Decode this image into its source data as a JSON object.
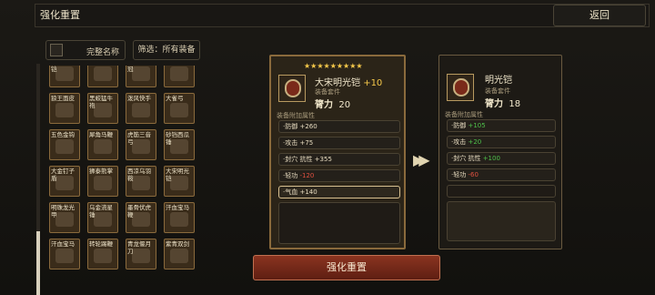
{
  "header": {
    "title": "强化重置",
    "back_label": "返回"
  },
  "left": {
    "show_full_name_label": "完整名称",
    "filter_label": "筛选：所有装备",
    "items": [
      {
        "label": "大宋明光铠"
      },
      {
        "label": "秋水长天"
      },
      {
        "label": "凤翅紫金冠"
      },
      {
        "label": "鸳鸯钺"
      },
      {
        "label": "狼王面皮"
      },
      {
        "label": "黑蛟猛牛袍"
      },
      {
        "label": "泼风快手"
      },
      {
        "label": "大雀弓"
      },
      {
        "label": "五色金钩"
      },
      {
        "label": "犀角马鞭"
      },
      {
        "label": "虎筋三音弓"
      },
      {
        "label": "砂铛西瓜锤"
      },
      {
        "label": "大金钉子盾"
      },
      {
        "label": "狮泰熊掌"
      },
      {
        "label": "西凉乌羽鞍"
      },
      {
        "label": "大宋明光铠"
      },
      {
        "label": "明珠龙光甲"
      },
      {
        "label": "乌金流星锤"
      },
      {
        "label": "墨骨伏虎鞭"
      },
      {
        "label": "汗血宝马"
      },
      {
        "label": "汗血宝马"
      },
      {
        "label": "转轮踢鞭"
      },
      {
        "label": "青龙偃月刀"
      },
      {
        "label": "紫青双剑"
      }
    ]
  },
  "left_card": {
    "stars": "★★★★★★★★★",
    "name": "大宋明光铠",
    "enhance": "+10",
    "type": "装备套件",
    "power_label": "膂力",
    "power_value": "20",
    "section_label": "装备附加属性",
    "attrs": [
      {
        "label": "·防御",
        "value": "+260",
        "tone": "normal"
      },
      {
        "label": "·攻击",
        "value": "+75",
        "tone": "normal"
      },
      {
        "label": "·封穴 抗性",
        "value": "+355",
        "tone": "normal"
      },
      {
        "label": "·轻功",
        "value": "-120",
        "tone": "red"
      },
      {
        "label": "·气血",
        "value": "+140",
        "tone": "normal"
      }
    ]
  },
  "right_card": {
    "name": "明光铠",
    "type": "装备套件",
    "power_label": "膂力",
    "power_value": "18",
    "section_label": "装备附加属性",
    "attrs": [
      {
        "label": "·防御",
        "value": "+105",
        "tone": "green"
      },
      {
        "label": "·攻击",
        "value": "+20",
        "tone": "green"
      },
      {
        "label": "·封穴 抗性",
        "value": "+100",
        "tone": "green"
      },
      {
        "label": "·轻功",
        "value": "-60",
        "tone": "red"
      }
    ]
  },
  "arrow": "▶▶",
  "action": {
    "label": "强化重置"
  }
}
